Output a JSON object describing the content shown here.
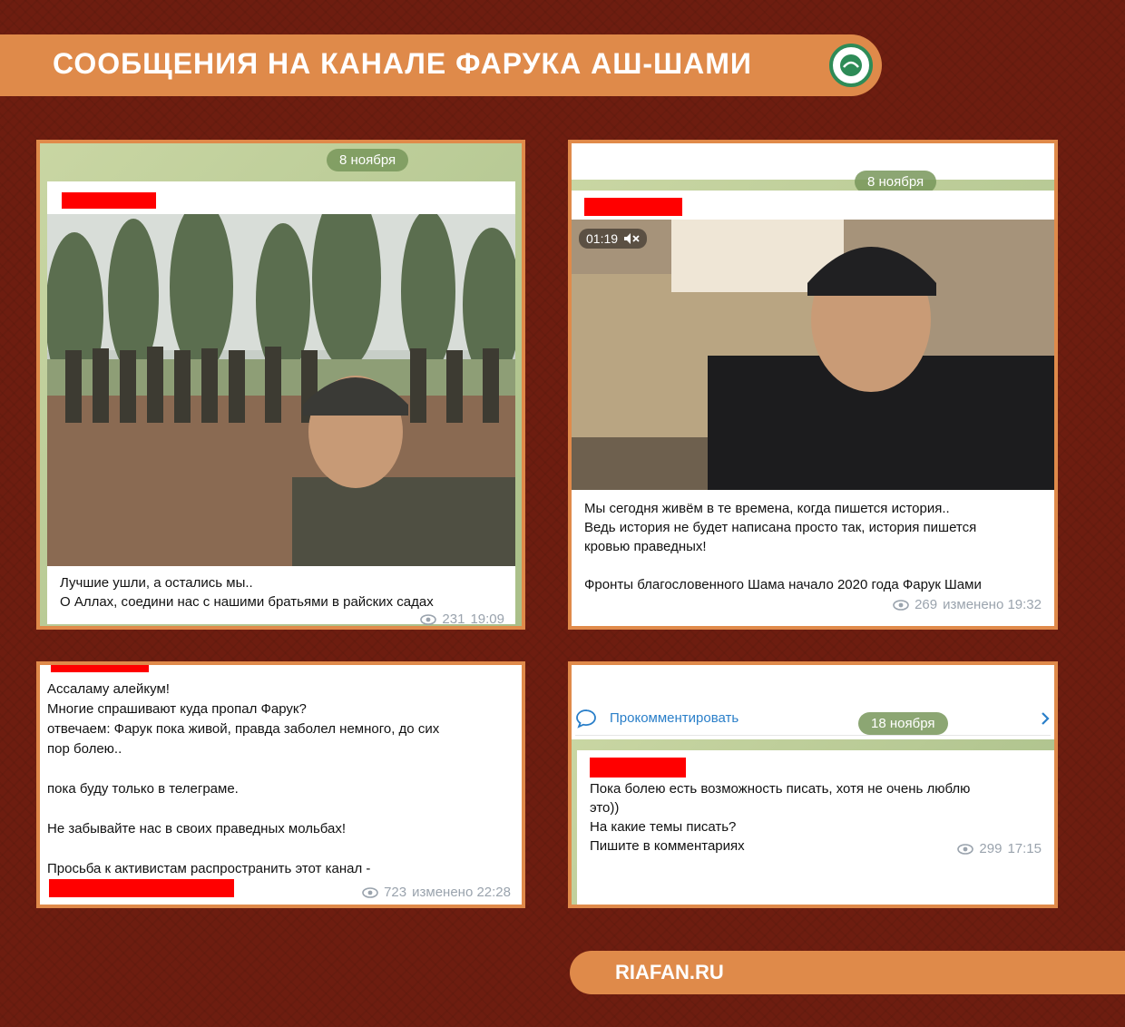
{
  "header": {
    "title": "СООБЩЕНИЯ НА КАНАЛЕ ФАРУКА АШ-ШАМИ"
  },
  "posts": [
    {
      "date": "8 ноября",
      "caption": "Лучшие ушли, а остались мы..\nО Аллах, соедини нас с нашими братьями в райских садах",
      "views": "231",
      "time": "19:09"
    },
    {
      "date": "8 ноября",
      "video_duration": "01:19",
      "caption": "Мы сегодня живём в те времена, когда пишется история..\nВедь история не будет написана просто так, история пишется\nкровью праведных!\n\nФронты благословенного Шама начало 2020 года Фарук Шами",
      "views": "269",
      "time": "изменено 19:32"
    },
    {
      "caption": "Ассаламу алейкум!\nМногие спрашивают куда пропал Фарук?\nотвечаем: Фарук пока живой, правда заболел немного, до сих\nпор болею..\n\nпока буду только в телеграме.\n\nНе забывайте нас в своих праведных мольбах!\n\nПросьба к активистам распространить этот канал -",
      "views": "723",
      "time": "изменено 22:28"
    },
    {
      "comment_label": "Прокомментировать",
      "date": "18 ноября",
      "caption": "Пока болею есть возможность писать, хотя не очень люблю\nэто))\nНа какие темы писать?\n Пишите в комментариях",
      "views": "299",
      "time": "17:15"
    }
  ],
  "footer": {
    "label": "RIAFAN.RU"
  },
  "colors": {
    "accent": "#df8a4a",
    "background": "#6e1d10",
    "redaction": "#ff0000"
  }
}
